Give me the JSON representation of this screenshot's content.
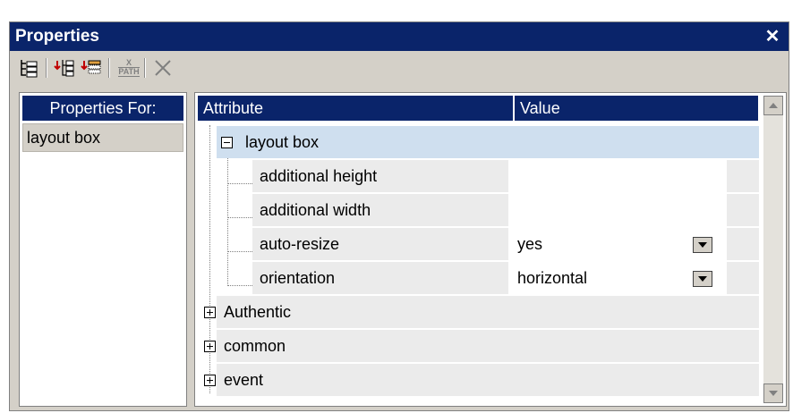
{
  "window": {
    "title": "Properties",
    "close_symbol": "✕"
  },
  "toolbar": {
    "icons": [
      "layout-tree-icon",
      "insert-child-icon",
      "insert-sibling-icon",
      "xpath-icon",
      "delete-icon"
    ],
    "xpath_icon_text": {
      "top": "X",
      "bottom": "PATH"
    }
  },
  "left_panel": {
    "header": "Properties For:",
    "selected_item": "layout box"
  },
  "grid": {
    "headers": {
      "attribute": "Attribute",
      "value": "Value"
    },
    "group": {
      "label": "layout box",
      "expanded": true
    },
    "properties": [
      {
        "name": "additional height",
        "value": "",
        "has_dropdown": false
      },
      {
        "name": "additional width",
        "value": "",
        "has_dropdown": false
      },
      {
        "name": "auto-resize",
        "value": "yes",
        "has_dropdown": true
      },
      {
        "name": "orientation",
        "value": "horizontal",
        "has_dropdown": true
      }
    ],
    "collapsed_groups": [
      "Authentic",
      "common",
      "event"
    ]
  },
  "colors": {
    "titlebar": "#0a246a",
    "selection_row": "#cfdfef",
    "chrome": "#d4d0c8"
  }
}
